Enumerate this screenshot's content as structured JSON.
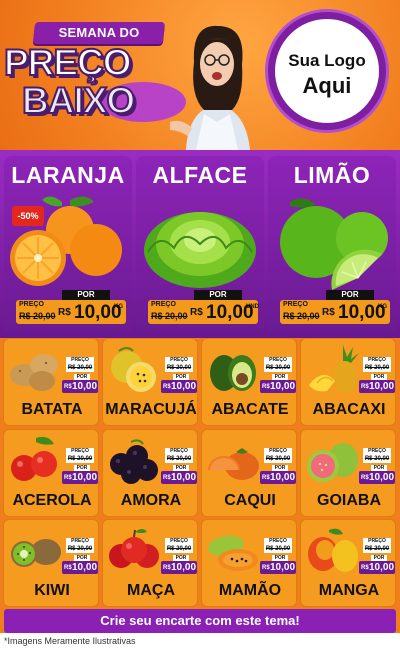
{
  "header": {
    "semana": "SEMANA DO",
    "preco": "PREÇO",
    "baixo": "BAIXO",
    "logo_line1": "Sua Logo",
    "logo_line2": "Aqui"
  },
  "featured": [
    {
      "name": "LARANJA",
      "preco_label": "PREÇO",
      "old_price": "R$ 20,00",
      "por_label": "POR",
      "currency": "R$",
      "price": "10,00",
      "unit": "KG",
      "discount": "-50%"
    },
    {
      "name": "ALFACE",
      "preco_label": "PREÇO",
      "old_price": "R$ 20,00",
      "por_label": "POR",
      "currency": "R$",
      "price": "10,00",
      "unit": "UND"
    },
    {
      "name": "LIMÃO",
      "preco_label": "PREÇO",
      "old_price": "R$ 20,00",
      "por_label": "POR",
      "currency": "R$",
      "price": "10,00",
      "unit": "KG"
    }
  ],
  "products": [
    {
      "name": "BATATA",
      "preco_label": "PREÇO",
      "old_price": "R$ 20,00",
      "por_label": "POR",
      "currency": "R$",
      "price": "10,00"
    },
    {
      "name": "MARACUJÁ",
      "preco_label": "PREÇO",
      "old_price": "R$ 20,00",
      "por_label": "POR",
      "currency": "R$",
      "price": "10,00"
    },
    {
      "name": "ABACATE",
      "preco_label": "PREÇO",
      "old_price": "R$ 20,00",
      "por_label": "POR",
      "currency": "R$",
      "price": "10,00"
    },
    {
      "name": "ABACAXI",
      "preco_label": "PREÇO",
      "old_price": "R$ 20,00",
      "por_label": "POR",
      "currency": "R$",
      "price": "10,00"
    },
    {
      "name": "ACEROLA",
      "preco_label": "PREÇO",
      "old_price": "R$ 20,00",
      "por_label": "POR",
      "currency": "R$",
      "price": "10,00"
    },
    {
      "name": "AMORA",
      "preco_label": "PREÇO",
      "old_price": "R$ 20,00",
      "por_label": "POR",
      "currency": "R$",
      "price": "10,00"
    },
    {
      "name": "CAQUI",
      "preco_label": "PREÇO",
      "old_price": "R$ 20,00",
      "por_label": "POR",
      "currency": "R$",
      "price": "10,00"
    },
    {
      "name": "GOIABA",
      "preco_label": "PREÇO",
      "old_price": "R$ 20,00",
      "por_label": "POR",
      "currency": "R$",
      "price": "10,00"
    },
    {
      "name": "KIWI",
      "preco_label": "PREÇO",
      "old_price": "R$ 20,00",
      "por_label": "POR",
      "currency": "R$",
      "price": "10,00"
    },
    {
      "name": "MAÇA",
      "preco_label": "PREÇO",
      "old_price": "R$ 20,00",
      "por_label": "POR",
      "currency": "R$",
      "price": "10,00"
    },
    {
      "name": "MAMÃO",
      "preco_label": "PREÇO",
      "old_price": "R$ 20,00",
      "por_label": "POR",
      "currency": "R$",
      "price": "10,00"
    },
    {
      "name": "MANGA",
      "preco_label": "PREÇO",
      "old_price": "R$ 20,00",
      "por_label": "POR",
      "currency": "R$",
      "price": "10,00"
    }
  ],
  "footer": {
    "cta": "Crie seu encarte com este tema!",
    "disclaimer": "*Imagens Meramente Ilustrativas"
  }
}
